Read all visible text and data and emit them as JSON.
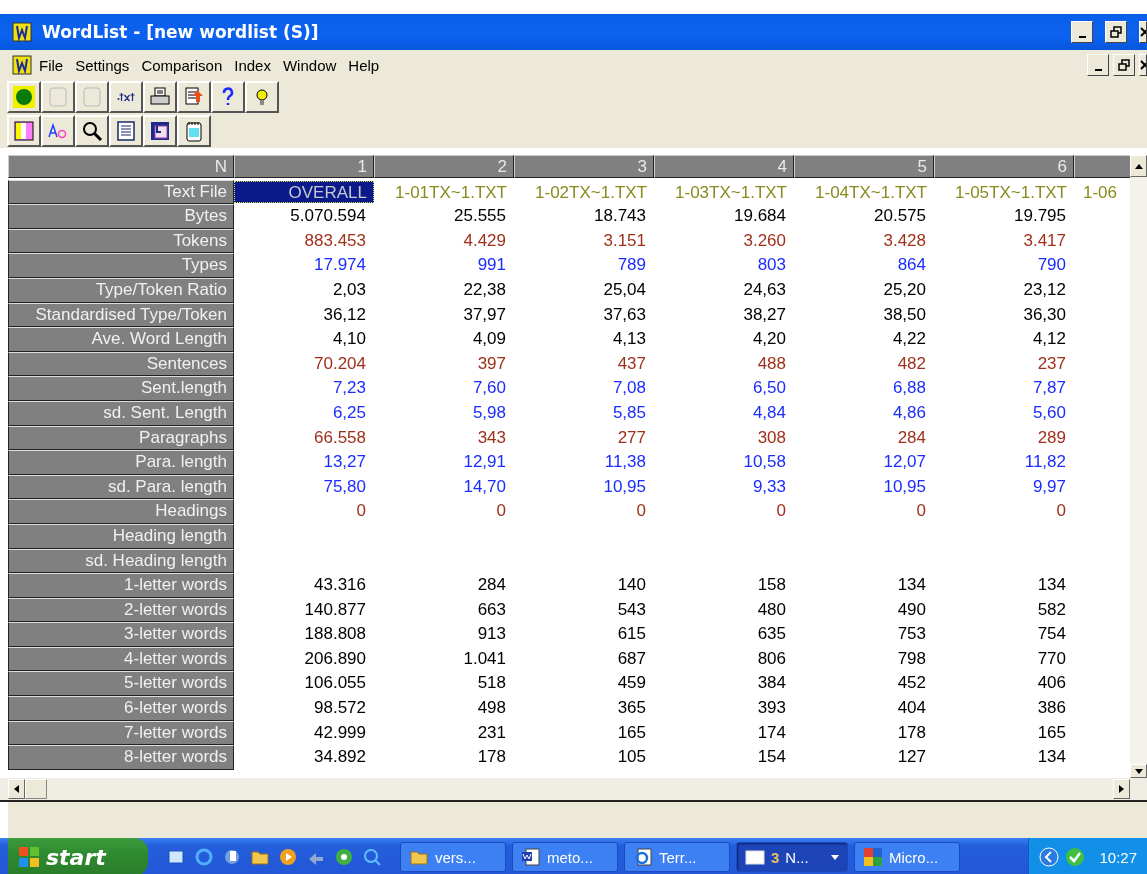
{
  "window": {
    "title": "WordList - [new wordlist (S)]"
  },
  "menu": [
    "File",
    "Settings",
    "Comparison",
    "Index",
    "Window",
    "Help"
  ],
  "grid": {
    "corner": "N",
    "columns": [
      "1",
      "2",
      "3",
      "4",
      "5",
      "6"
    ],
    "rows": [
      {
        "label": "Text File",
        "kind": "files",
        "color": "#8a8a1e",
        "cells": [
          {
            "text": "OVERALL",
            "selected": true
          },
          {
            "text": "1-01TX~1.TXT",
            "selected": false
          },
          {
            "text": "1-02TX~1.TXT",
            "selected": false
          },
          {
            "text": "1-03TX~1.TXT",
            "selected": false
          },
          {
            "text": "1-04TX~1.TXT",
            "selected": false
          },
          {
            "text": "1-05TX~1.TXT",
            "selected": false
          },
          {
            "text": "1-06",
            "selected": false
          }
        ]
      },
      {
        "label": "Bytes",
        "kind": "values",
        "color": "#000000",
        "values": [
          "5.070.594",
          "25.555",
          "18.743",
          "19.684",
          "20.575",
          "19.795"
        ]
      },
      {
        "label": "Tokens",
        "kind": "values",
        "color": "#a0301c",
        "values": [
          "883.453",
          "4.429",
          "3.151",
          "3.260",
          "3.428",
          "3.417"
        ]
      },
      {
        "label": "Types",
        "kind": "values",
        "color": "#1a2cff",
        "values": [
          "17.974",
          "991",
          "789",
          "803",
          "864",
          "790"
        ]
      },
      {
        "label": "Type/Token Ratio",
        "kind": "values",
        "color": "#000000",
        "values": [
          "2,03",
          "22,38",
          "25,04",
          "24,63",
          "25,20",
          "23,12"
        ]
      },
      {
        "label": "Standardised Type/Token",
        "kind": "values",
        "color": "#000000",
        "values": [
          "36,12",
          "37,97",
          "37,63",
          "38,27",
          "38,50",
          "36,30"
        ]
      },
      {
        "label": "Ave. Word Length",
        "kind": "values",
        "color": "#000000",
        "values": [
          "4,10",
          "4,09",
          "4,13",
          "4,20",
          "4,22",
          "4,12"
        ]
      },
      {
        "label": "Sentences",
        "kind": "values",
        "color": "#a0301c",
        "values": [
          "70.204",
          "397",
          "437",
          "488",
          "482",
          "237"
        ]
      },
      {
        "label": "Sent.length",
        "kind": "values",
        "color": "#1a2cff",
        "values": [
          "7,23",
          "7,60",
          "7,08",
          "6,50",
          "6,88",
          "7,87"
        ]
      },
      {
        "label": "sd. Sent. Length",
        "kind": "values",
        "color": "#1a2cff",
        "values": [
          "6,25",
          "5,98",
          "5,85",
          "4,84",
          "4,86",
          "5,60"
        ]
      },
      {
        "label": "Paragraphs",
        "kind": "values",
        "color": "#a0301c",
        "values": [
          "66.558",
          "343",
          "277",
          "308",
          "284",
          "289"
        ]
      },
      {
        "label": "Para. length",
        "kind": "values",
        "color": "#1a2cff",
        "values": [
          "13,27",
          "12,91",
          "11,38",
          "10,58",
          "12,07",
          "11,82"
        ]
      },
      {
        "label": "sd. Para. length",
        "kind": "values",
        "color": "#1a2cff",
        "values": [
          "75,80",
          "14,70",
          "10,95",
          "9,33",
          "10,95",
          "9,97"
        ]
      },
      {
        "label": "Headings",
        "kind": "values",
        "color": "#a0301c",
        "values": [
          "0",
          "0",
          "0",
          "0",
          "0",
          "0"
        ]
      },
      {
        "label": "Heading length",
        "kind": "values"
      },
      {
        "label": "sd. Heading length",
        "kind": "values"
      },
      {
        "label": "1-letter words",
        "kind": "values",
        "color": "#000000",
        "values": [
          "43.316",
          "284",
          "140",
          "158",
          "134",
          "134"
        ]
      },
      {
        "label": "2-letter words",
        "kind": "values",
        "color": "#000000",
        "values": [
          "140.877",
          "663",
          "543",
          "480",
          "490",
          "582"
        ]
      },
      {
        "label": "3-letter words",
        "kind": "values",
        "color": "#000000",
        "values": [
          "188.808",
          "913",
          "615",
          "635",
          "753",
          "754"
        ]
      },
      {
        "label": "4-letter words",
        "kind": "values",
        "color": "#000000",
        "values": [
          "206.890",
          "1.041",
          "687",
          "806",
          "798",
          "770"
        ]
      },
      {
        "label": "5-letter words",
        "kind": "values",
        "color": "#000000",
        "values": [
          "106.055",
          "518",
          "459",
          "384",
          "452",
          "406"
        ]
      },
      {
        "label": "6-letter words",
        "kind": "values",
        "color": "#000000",
        "values": [
          "98.572",
          "498",
          "365",
          "393",
          "404",
          "386"
        ]
      },
      {
        "label": "7-letter words",
        "kind": "values",
        "color": "#000000",
        "values": [
          "42.999",
          "231",
          "165",
          "174",
          "178",
          "165"
        ]
      },
      {
        "label": "8-letter words",
        "kind": "values",
        "color": "#000000",
        "values": [
          "34.892",
          "178",
          "105",
          "154",
          "127",
          "134"
        ]
      }
    ]
  },
  "taskbar": {
    "start": "start",
    "tasks": [
      {
        "kind": "folder",
        "label": "vers...",
        "selected": false
      },
      {
        "kind": "word",
        "label": "meto...",
        "selected": false
      },
      {
        "kind": "browser",
        "label": "Terr...",
        "selected": false
      },
      {
        "kind": "group",
        "count": "3",
        "label": "N...",
        "selected": true
      },
      {
        "kind": "puzzle",
        "label": "Micro...",
        "selected": false
      }
    ],
    "clock": "10:27"
  }
}
